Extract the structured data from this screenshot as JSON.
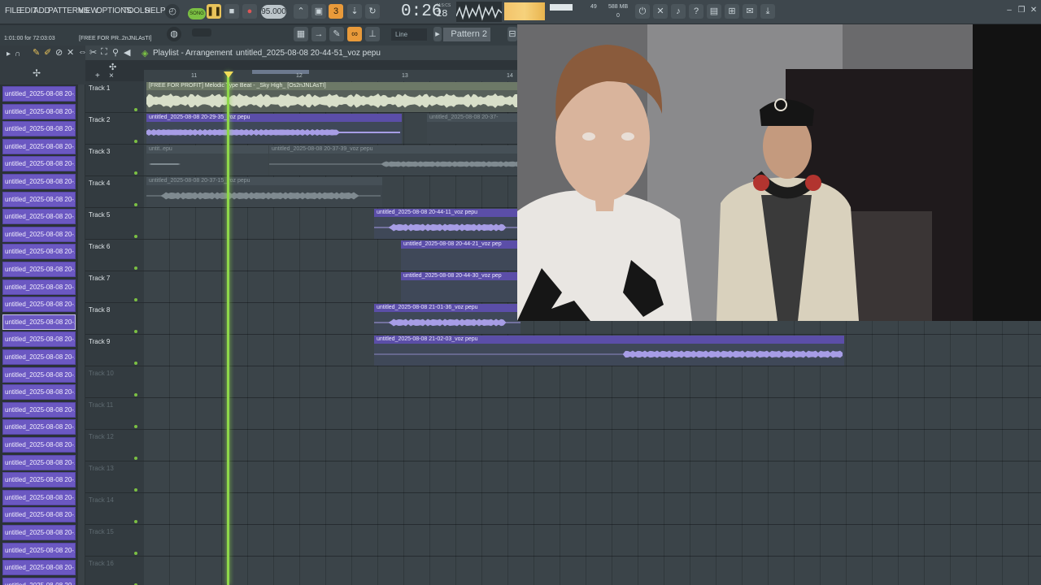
{
  "menu": [
    "FILE",
    "EDIT",
    "ADD",
    "PATTERNS",
    "VIEW",
    "OPTIONS",
    "TOOLS",
    "HELP"
  ],
  "transport": {
    "mode": "SONG",
    "bpm": "95.000",
    "time": "0:26",
    "time_sub": "18",
    "time_unit": "M:S:CS"
  },
  "stats": {
    "cpu": "49",
    "memory": "588 MB",
    "polyphony": "0"
  },
  "hint": {
    "position": "1:01:00 for 72:03:03",
    "text": "[FREE FOR PR..2nJNLAsTI]"
  },
  "snap": {
    "mode": "Line"
  },
  "pattern": {
    "name": "Pattern 2"
  },
  "playlist": {
    "title": "Playlist - Arrangement",
    "separator": "›",
    "current": "untitled_2025-08-08 20-44-51_voz pepu",
    "ruler": [
      "11",
      "12",
      "13",
      "14"
    ],
    "tracks": [
      {
        "name": "Track 1",
        "empty": false
      },
      {
        "name": "Track 2",
        "empty": false
      },
      {
        "name": "Track 3",
        "empty": false
      },
      {
        "name": "Track 4",
        "empty": false
      },
      {
        "name": "Track 5",
        "empty": false
      },
      {
        "name": "Track 6",
        "empty": false
      },
      {
        "name": "Track 7",
        "empty": false
      },
      {
        "name": "Track 8",
        "empty": false
      },
      {
        "name": "Track 9",
        "empty": false
      },
      {
        "name": "Track 10",
        "empty": true
      },
      {
        "name": "Track 11",
        "empty": true
      },
      {
        "name": "Track 12",
        "empty": true
      },
      {
        "name": "Track 13",
        "empty": true
      },
      {
        "name": "Track 14",
        "empty": true
      },
      {
        "name": "Track 15",
        "empty": true
      },
      {
        "name": "Track 16",
        "empty": true
      }
    ],
    "clips": [
      {
        "label": "[FREE FOR PROFIT] Melodic Type Beat - _Sky High_ [Os2nJNLAsTI]"
      },
      {
        "label": "untitled_2025-08-08 20-29-35_voz pepu"
      },
      {
        "label": "untitled_2025-08-08 20-37-"
      },
      {
        "label": "untit..epu"
      },
      {
        "label": "untitled_2025-08-08 20-37-39_voz pepu"
      },
      {
        "label": "untitled_2025-08-08 20-37-15_voz pepu"
      },
      {
        "label": "untitled_2025-08-08 20-44-11_voz pepu"
      },
      {
        "label": "untitled_2025-08-08 20-44-21_voz pep"
      },
      {
        "label": "untitled_2025-08-08 20-44-30_voz pep"
      },
      {
        "label": "untitled_2025-08-08 21-01-36_voz pepu"
      },
      {
        "label": "untitled_2025-08-08 21-02-03_voz pepu"
      }
    ]
  },
  "browser": {
    "item_label": "untitled_2025-08-08 20-...",
    "last_item_label": "untitled_2025-08-08 20-1"
  },
  "colors": {
    "accent_green": "#7bc043",
    "clip_purple": "#5b4ea8",
    "browser_purple": "#6b58c2"
  }
}
